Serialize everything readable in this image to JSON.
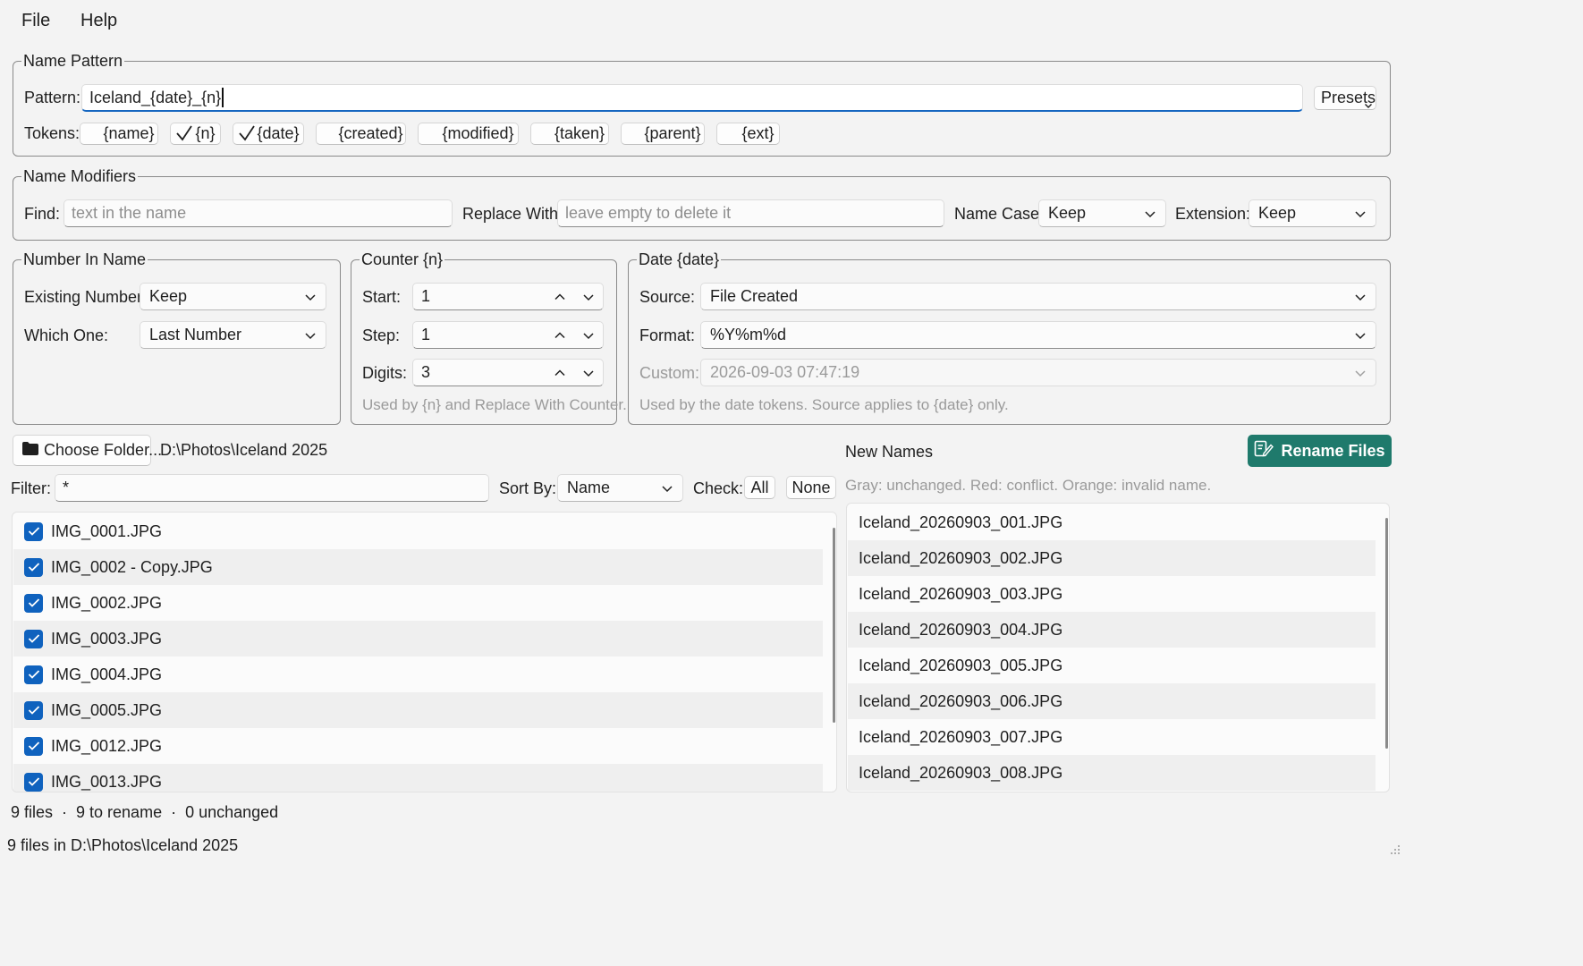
{
  "menu": {
    "file": "File",
    "help": "Help"
  },
  "name_pattern": {
    "legend": "Name Pattern",
    "pattern_label": "Pattern:",
    "pattern_value": "Iceland_{date}_{n}",
    "presets_label": "Presets",
    "tokens_label": "Tokens:",
    "tokens": [
      {
        "label": "{name}",
        "checked": false
      },
      {
        "label": "{n}",
        "checked": true
      },
      {
        "label": "{date}",
        "checked": true
      },
      {
        "label": "{created}",
        "checked": false
      },
      {
        "label": "{modified}",
        "checked": false
      },
      {
        "label": "{taken}",
        "checked": false
      },
      {
        "label": "{parent}",
        "checked": false
      },
      {
        "label": "{ext}",
        "checked": false
      }
    ]
  },
  "name_modifiers": {
    "legend": "Name Modifiers",
    "find_label": "Find:",
    "find_placeholder": "text in the name",
    "replace_label": "Replace With:",
    "replace_placeholder": "leave empty to delete it",
    "case_label": "Name Case:",
    "case_value": "Keep",
    "ext_label": "Extension:",
    "ext_value": "Keep"
  },
  "number_in_name": {
    "legend": "Number In Name",
    "existing_label": "Existing Number:",
    "existing_value": "Keep",
    "which_label": "Which One:",
    "which_value": "Last Number"
  },
  "counter": {
    "legend": "Counter  {n}",
    "start_label": "Start:",
    "start_value": "1",
    "step_label": "Step:",
    "step_value": "1",
    "digits_label": "Digits:",
    "digits_value": "3",
    "hint": "Used by {n} and Replace With Counter."
  },
  "date": {
    "legend": "Date  {date}",
    "source_label": "Source:",
    "source_value": "File Created",
    "format_label": "Format:",
    "format_value": "%Y%m%d",
    "custom_label": "Custom:",
    "custom_value": "2026-09-03 07:47:19",
    "hint": "Used by the date tokens. Source applies to {date} only."
  },
  "folder": {
    "choose_label": "Choose Folder...",
    "path": "D:\\Photos\\Iceland 2025"
  },
  "filter": {
    "filter_label": "Filter:",
    "filter_value": "*",
    "sort_label": "Sort By:",
    "sort_value": "Name",
    "check_label": "Check:",
    "all_label": "All",
    "none_label": "None"
  },
  "new_names": {
    "title": "New Names",
    "rename_label": "Rename Files",
    "legend_text": "Gray: unchanged.  Red: conflict.  Orange: invalid name."
  },
  "files": [
    "IMG_0001.JPG",
    "IMG_0002 - Copy.JPG",
    "IMG_0002.JPG",
    "IMG_0003.JPG",
    "IMG_0004.JPG",
    "IMG_0005.JPG",
    "IMG_0012.JPG",
    "IMG_0013.JPG"
  ],
  "new_files": [
    "Iceland_20260903_001.JPG",
    "Iceland_20260903_002.JPG",
    "Iceland_20260903_003.JPG",
    "Iceland_20260903_004.JPG",
    "Iceland_20260903_005.JPG",
    "Iceland_20260903_006.JPG",
    "Iceland_20260903_007.JPG",
    "Iceland_20260903_008.JPG"
  ],
  "status": {
    "summary": "9 files  ·  9 to rename  ·  0 unchanged",
    "bar": "9 files in D:\\Photos\\Iceland 2025"
  },
  "colors": {
    "accent": "#1566c0",
    "checkbox": "#0f62be",
    "primary_button": "#1f7a6c"
  }
}
